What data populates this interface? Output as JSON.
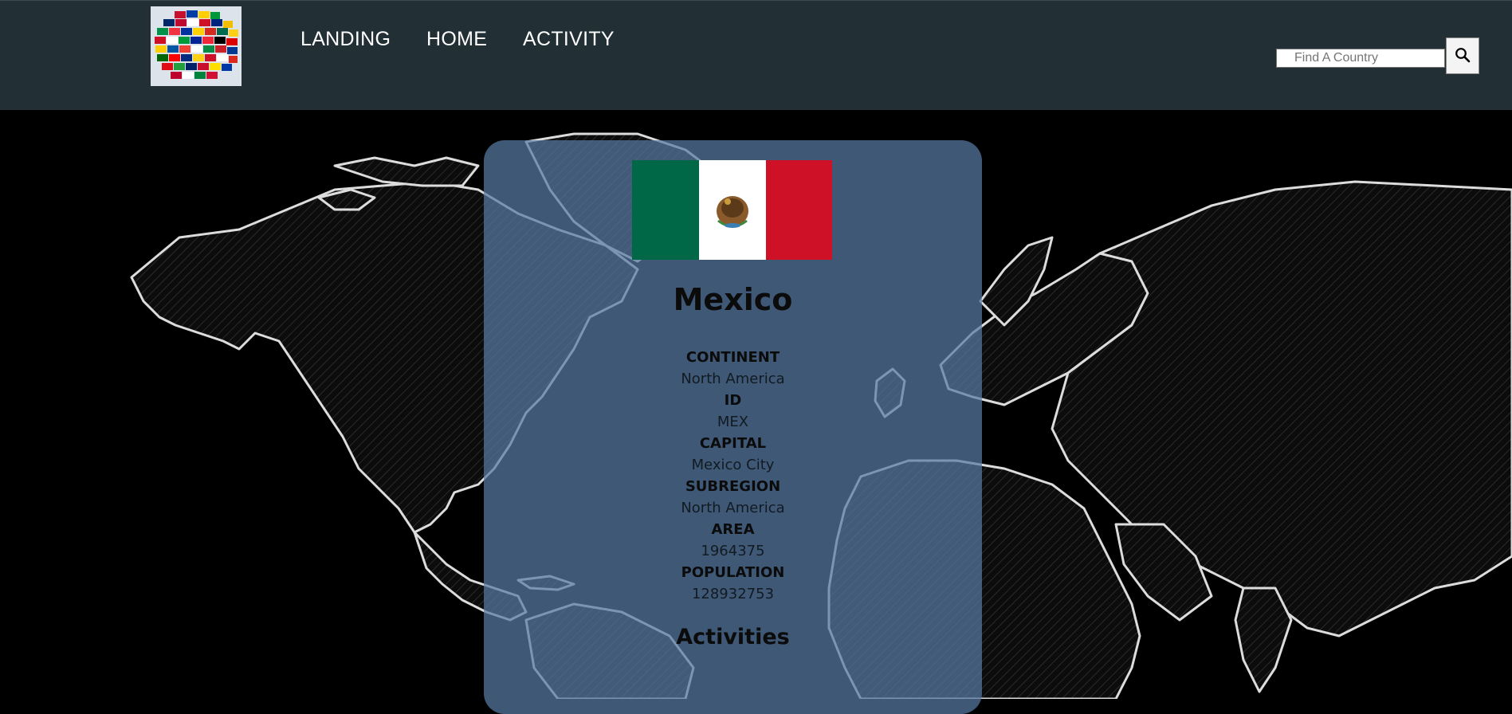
{
  "nav": {
    "links": [
      {
        "label": "LANDING"
      },
      {
        "label": "HOME"
      },
      {
        "label": "ACTIVITY"
      }
    ]
  },
  "search": {
    "placeholder": "Find A Country",
    "value": ""
  },
  "country": {
    "name": "Mexico",
    "fields": [
      {
        "label": "CONTINENT",
        "value": "North America"
      },
      {
        "label": "ID",
        "value": "MEX"
      },
      {
        "label": "CAPITAL",
        "value": "Mexico City"
      },
      {
        "label": "SUBREGION",
        "value": "North America"
      },
      {
        "label": "AREA",
        "value": "1964375"
      },
      {
        "label": "POPULATION",
        "value": "128932753"
      }
    ],
    "flag_colors": [
      "#006847",
      "#ffffff",
      "#ce1126"
    ],
    "activities_title": "Activities"
  },
  "colors": {
    "navbar": "#222f35",
    "card": "#567aa3",
    "map_background": "#000000",
    "map_outline": "#ffffff"
  },
  "icons": {
    "search": "search-icon",
    "logo": "world-flags-logo"
  }
}
